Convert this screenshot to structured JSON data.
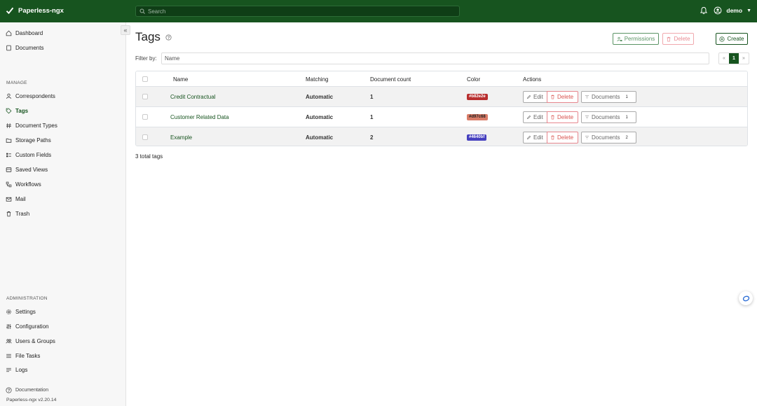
{
  "app": {
    "brand": "Paperless-ngx"
  },
  "search": {
    "placeholder": "Search"
  },
  "user": {
    "name": "demo"
  },
  "sidebar": {
    "main": [
      {
        "label": "Dashboard",
        "icon": "house-icon"
      },
      {
        "label": "Documents",
        "icon": "file-icon"
      }
    ],
    "manage_label": "MANAGE",
    "manage": [
      {
        "label": "Correspondents",
        "icon": "person-icon"
      },
      {
        "label": "Tags",
        "icon": "tag-icon"
      },
      {
        "label": "Document Types",
        "icon": "hash-icon"
      },
      {
        "label": "Storage Paths",
        "icon": "folder-icon"
      },
      {
        "label": "Custom Fields",
        "icon": "custom-fields-icon"
      },
      {
        "label": "Saved Views",
        "icon": "saved-views-icon"
      },
      {
        "label": "Workflows",
        "icon": "workflow-icon"
      },
      {
        "label": "Mail",
        "icon": "mail-icon"
      },
      {
        "label": "Trash",
        "icon": "trash-icon"
      }
    ],
    "admin_label": "ADMINISTRATION",
    "admin": [
      {
        "label": "Settings",
        "icon": "gear-icon"
      },
      {
        "label": "Configuration",
        "icon": "sliders-icon"
      },
      {
        "label": "Users & Groups",
        "icon": "people-icon"
      },
      {
        "label": "File Tasks",
        "icon": "list-icon"
      },
      {
        "label": "Logs",
        "icon": "logs-icon"
      }
    ],
    "documentation": "Documentation",
    "version": "Paperless-ngx v2.20.14"
  },
  "page": {
    "title": "Tags",
    "permissions_label": "Permissions",
    "delete_label": "Delete",
    "create_label": "Create",
    "filter_label": "Filter by:",
    "filter_placeholder": "Name",
    "pager": {
      "prev": "«",
      "current": "1",
      "next": "»"
    },
    "total": "3 total tags"
  },
  "table": {
    "headers": [
      "Name",
      "Matching",
      "Document count",
      "Color",
      "Actions"
    ],
    "rows": [
      {
        "name": "Credit Contractual",
        "matching": "Automatic",
        "count": "1",
        "color": "#b82e2e",
        "docs": "1"
      },
      {
        "name": "Customer Related Data",
        "matching": "Automatic",
        "count": "1",
        "color": "#d97c68",
        "docs": "1"
      },
      {
        "name": "Example",
        "matching": "Automatic",
        "count": "2",
        "color": "#4640bf",
        "docs": "2"
      }
    ],
    "edit_label": "Edit",
    "delete_label": "Delete",
    "documents_label": "Documents"
  },
  "colors": {
    "brand": "#17541f",
    "danger": "#d9534f"
  }
}
